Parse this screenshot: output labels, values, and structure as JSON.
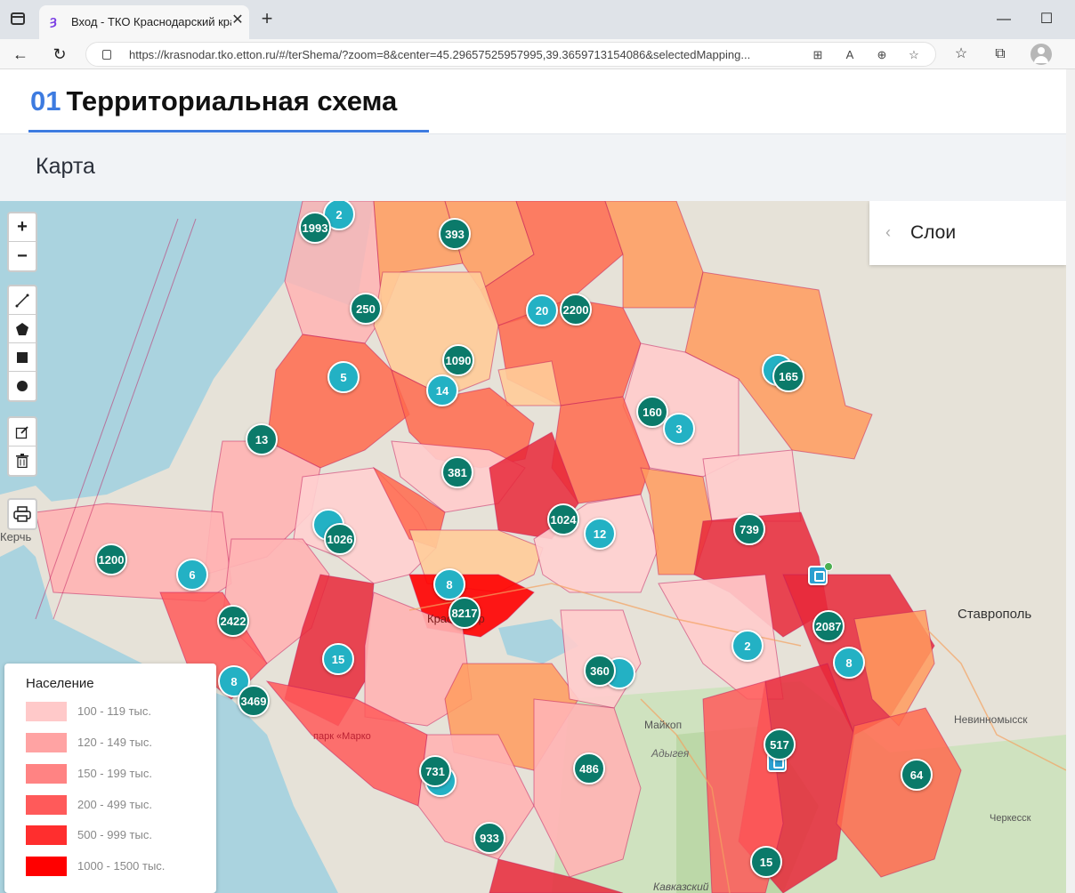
{
  "browser": {
    "tab_title": "Вход - ТКО Краснодарский кра",
    "url": "https://krasnodar.tko.etton.ru/#/terShema/?zoom=8&center=45.29657525957995,39.3659713154086&selectedMapping..."
  },
  "page": {
    "section_number": "01",
    "title": "Территориальная схема",
    "subtitle": "Карта"
  },
  "map": {
    "layers_label": "Слои",
    "controls": {
      "zoom_in": "+",
      "zoom_out": "−"
    },
    "legend": {
      "title": "Население",
      "items": [
        {
          "label": "100 - 119 тыс.",
          "color": "#ffc9c9"
        },
        {
          "label": "120 - 149 тыс.",
          "color": "#ffa3a3"
        },
        {
          "label": "150 - 199 тыс.",
          "color": "#ff8383"
        },
        {
          "label": "200 - 499 тыс.",
          "color": "#ff5a5a"
        },
        {
          "label": "500 - 999 тыс.",
          "color": "#ff2e2e"
        },
        {
          "label": "1000 - 1500 тыс.",
          "color": "#ff0000"
        }
      ]
    },
    "place_labels": {
      "kerch": "Керчь",
      "stavropol": "Ставрополь",
      "nevinnomyssk": "Невинномысск",
      "maykop": "Майкоп",
      "adygea": "Адыгея",
      "cherkessk": "Черкесск",
      "kavkazskiy": "Кавказский",
      "krasnodar": "Краснодар",
      "park": "парк «Марко"
    },
    "clusters": [
      {
        "value": "2",
        "style": "light"
      },
      {
        "value": "1993",
        "style": "dark"
      },
      {
        "value": "393",
        "style": "dark"
      },
      {
        "value": "250",
        "style": "dark"
      },
      {
        "value": "20",
        "style": "light"
      },
      {
        "value": "2200",
        "style": "dark"
      },
      {
        "value": "1090",
        "style": "dark"
      },
      {
        "value": "5",
        "style": "light"
      },
      {
        "value": "14",
        "style": "light"
      },
      {
        "value": "165",
        "style": "dark"
      },
      {
        "value": "160",
        "style": "dark"
      },
      {
        "value": "3",
        "style": "light"
      },
      {
        "value": "13",
        "style": "dark"
      },
      {
        "value": "381",
        "style": "dark"
      },
      {
        "value": "1026",
        "style": "dark"
      },
      {
        "value": "1024",
        "style": "dark"
      },
      {
        "value": "12",
        "style": "light"
      },
      {
        "value": "739",
        "style": "dark"
      },
      {
        "value": "1200",
        "style": "dark"
      },
      {
        "value": "6",
        "style": "light"
      },
      {
        "value": "8",
        "style": "light"
      },
      {
        "value": "8217",
        "style": "dark"
      },
      {
        "value": "2422",
        "style": "dark"
      },
      {
        "value": "2087",
        "style": "dark"
      },
      {
        "value": "15",
        "style": "light"
      },
      {
        "value": "2",
        "style": "light"
      },
      {
        "value": "8",
        "style": "light"
      },
      {
        "value": "360",
        "style": "dark"
      },
      {
        "value": "8",
        "style": "light"
      },
      {
        "value": "3469",
        "style": "dark"
      },
      {
        "value": "517",
        "style": "dark"
      },
      {
        "value": "731",
        "style": "dark"
      },
      {
        "value": "486",
        "style": "dark"
      },
      {
        "value": "64",
        "style": "dark"
      },
      {
        "value": "933",
        "style": "dark"
      },
      {
        "value": "15",
        "style": "dark"
      }
    ]
  }
}
